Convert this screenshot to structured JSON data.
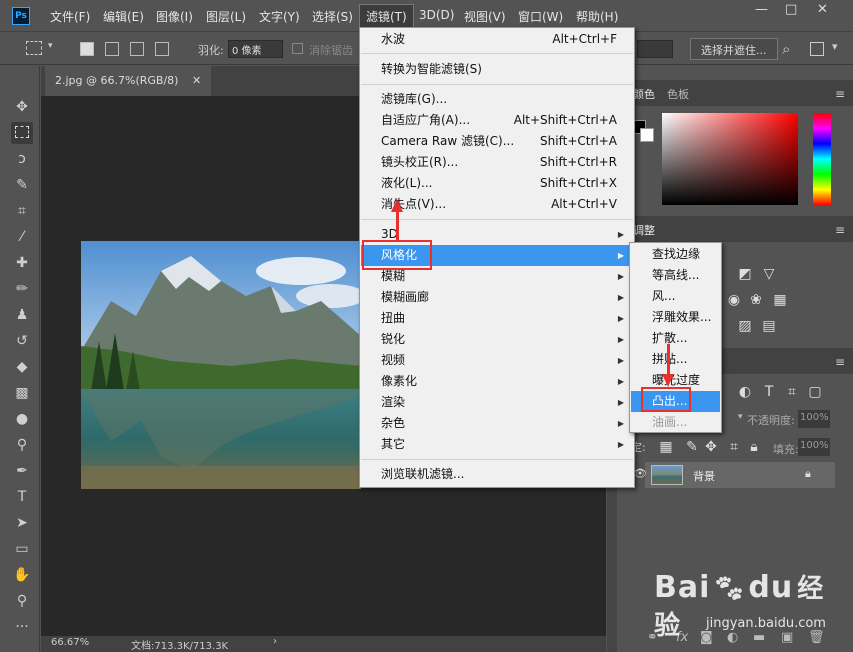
{
  "app": {
    "logo": "Ps"
  },
  "menubar": {
    "items": [
      "文件(F)",
      "编辑(E)",
      "图像(I)",
      "图层(L)",
      "文字(Y)",
      "选择(S)",
      "滤镜(T)",
      "3D(D)",
      "视图(V)",
      "窗口(W)",
      "帮助(H)"
    ],
    "active": "滤镜(T)",
    "window_controls": [
      "—",
      "□",
      "✕"
    ]
  },
  "options": {
    "feather_label": "羽化:",
    "feather_value": "0 像素",
    "antialias_label": "消除锯齿",
    "select_mask_button": "选择并遮住..."
  },
  "document": {
    "tab_title": "2.jpg @ 66.7%(RGB/8)",
    "tab_close": "✕",
    "zoom": "66.67%",
    "doc_info": "文档:713.3K/713.3K"
  },
  "panels": {
    "color_tab": "颜色",
    "swatches_tab": "色板",
    "adjust_tab": "调整",
    "layers_opacity_label": "不透明度:",
    "layers_opacity_value": "100%",
    "layers_fill_label": "填充:",
    "layers_fill_value": "100%",
    "lock_label": "锁定:",
    "layer_name": "背景"
  },
  "filter_menu": {
    "items": [
      {
        "label": "水波",
        "shortcut": "Alt+Ctrl+F"
      },
      {
        "label": "转换为智能滤镜(S)",
        "shortcut": ""
      },
      {
        "label": "滤镜库(G)...",
        "shortcut": ""
      },
      {
        "label": "自适应广角(A)...",
        "shortcut": "Alt+Shift+Ctrl+A"
      },
      {
        "label": "Camera Raw 滤镜(C)...",
        "shortcut": "Shift+Ctrl+A"
      },
      {
        "label": "镜头校正(R)...",
        "shortcut": "Shift+Ctrl+R"
      },
      {
        "label": "液化(L)...",
        "shortcut": "Shift+Ctrl+X"
      },
      {
        "label": "消失点(V)...",
        "shortcut": "Alt+Ctrl+V"
      },
      {
        "label": "3D",
        "shortcut": ""
      },
      {
        "label": "风格化",
        "shortcut": ""
      },
      {
        "label": "模糊",
        "shortcut": ""
      },
      {
        "label": "模糊画廊",
        "shortcut": ""
      },
      {
        "label": "扭曲",
        "shortcut": ""
      },
      {
        "label": "锐化",
        "shortcut": ""
      },
      {
        "label": "视频",
        "shortcut": ""
      },
      {
        "label": "像素化",
        "shortcut": ""
      },
      {
        "label": "渲染",
        "shortcut": ""
      },
      {
        "label": "杂色",
        "shortcut": ""
      },
      {
        "label": "其它",
        "shortcut": ""
      },
      {
        "label": "浏览联机滤镜...",
        "shortcut": ""
      }
    ],
    "highlighted": "风格化"
  },
  "stylize_submenu": {
    "items": [
      "查找边缘",
      "等高线...",
      "风...",
      "浮雕效果...",
      "扩散...",
      "拼贴...",
      "曝光过度",
      "凸出...",
      "油画..."
    ],
    "highlighted": "凸出...",
    "disabled": "油画..."
  },
  "watermark": {
    "brand": "Bai",
    "brand2": "du",
    "brand_cn": "经验",
    "url": "jingyan.baidu.com"
  },
  "colors": {
    "highlight": "#3b96ef",
    "annotation": "#e8312f"
  }
}
